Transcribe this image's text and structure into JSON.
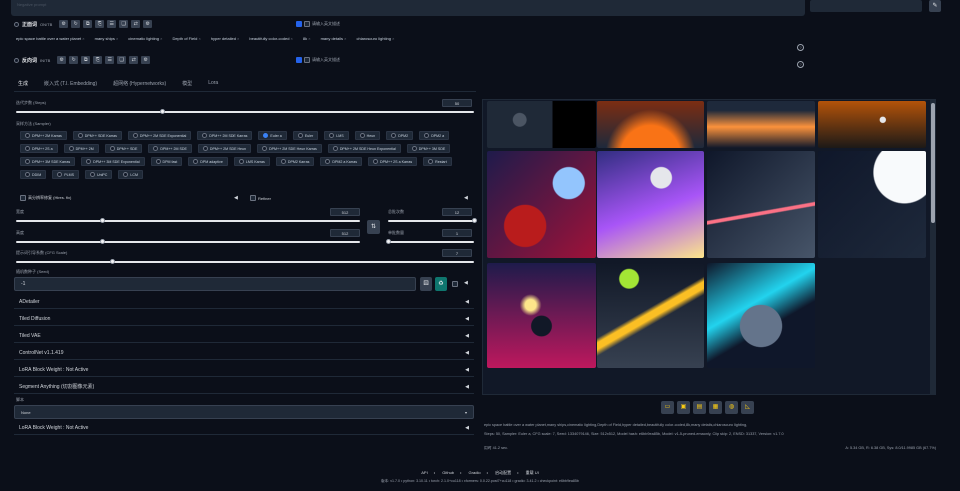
{
  "prompt_area": {
    "placeholder": "Negative prompt"
  },
  "positive": {
    "label": "正面词",
    "sub": "ON/TB",
    "checkbox_label": "请输入英文描述",
    "tags": [
      "epic space battle over a water planet",
      "many ships",
      "cinematic lighting",
      "Depth of Field",
      "hyper detailed",
      "beautifully color-coded",
      "8k",
      "many details",
      "chiaroscuro lighting"
    ]
  },
  "negative": {
    "label": "反向词",
    "sub": "IN/TB",
    "checkbox_label": "请输入英文描述"
  },
  "tabs": [
    "生成",
    "嵌入式 (T.I. Embedding)",
    "超网络 (Hypernetworks)",
    "模型",
    "Lora"
  ],
  "steps": {
    "label": "迭代步数 (Steps)",
    "value": "50",
    "fraction": 0.32
  },
  "sampler": {
    "label": "采样方法 (Sampler)",
    "selected": "Euler a",
    "options": [
      "DPM++ 2M Karras",
      "DPM++ SDE Karras",
      "DPM++ 2M SDE Exponential",
      "DPM++ 2M SDE Karras",
      "Euler a",
      "Euler",
      "LMS",
      "Heun",
      "DPM2",
      "DPM2 a",
      "DPM++ 2S a",
      "DPM++ 2M",
      "DPM++ SDE",
      "DPM++ 2M SDE",
      "DPM++ 2M SDE Heun",
      "DPM++ 2M SDE Heun Karras",
      "DPM++ 2M SDE Heun Exponential",
      "DPM++ 3M SDE",
      "DPM++ 3M SDE Karras",
      "DPM++ 3M SDE Exponential",
      "DPM fast",
      "DPM adaptive",
      "LMS Karras",
      "DPM2 Karras",
      "DPM2 a Karras",
      "DPM++ 2S a Karras",
      "Restart",
      "DDIM",
      "PLMS",
      "UniPC",
      "LCM"
    ]
  },
  "hires": {
    "label": "高分辨率修复 (Hires. fix)"
  },
  "refiner": {
    "label": "Refiner"
  },
  "width": {
    "label": "宽度",
    "value": "512",
    "fraction": 0.25
  },
  "height": {
    "label": "高度",
    "value": "512",
    "fraction": 0.25
  },
  "batch_count": {
    "label": "总批次数",
    "value": "12",
    "fraction": 1.0
  },
  "batch_size": {
    "label": "单批数量",
    "value": "1",
    "fraction": 0.0
  },
  "cfg": {
    "label": "提示词引导系数 (CFG Scale)",
    "value": "7",
    "fraction": 0.21
  },
  "seed": {
    "label": "随机数种子 (Seed)",
    "value": "-1"
  },
  "accordions": [
    "ADetailer",
    "Tiled Diffusion",
    "Tiled VAE",
    "ControlNet v1.1.419",
    "LoRA Block Weight : Not Active",
    "Segment Anything (切割图像元素)"
  ],
  "script": {
    "label": "脚本",
    "value": "None"
  },
  "last_accordion": "LoRA Block Weight : Not Active",
  "toolbar_icons": [
    "folder-icon",
    "save-icon",
    "zip-icon",
    "image-icon",
    "palette-icon",
    "ruler-icon"
  ],
  "info": {
    "line1": "epic space battle over a water planet,many ships,cinematic lighting,Depth of Field,hyper detailed,beautifully color-coded,8k,many details,chiaroscuro lighting,",
    "line2": "Steps: 50, Sampler: Euler a, CFG scale: 7, Seed: 1334079146, Size: 512x512, Model hash: e6bb9ea85b, Model: v1-5-pruned-emaonly, Clip skip: 2, ENSD: 31337, Version: v1.7.0",
    "time": "用时 41.2 sec.",
    "vram": "A: 5.34 GB, R: 6.38 GB, Sys: 8.0/11.9985 GB (67.7%)"
  },
  "footer": {
    "links": [
      "API",
      "Github",
      "Gradio",
      "启动配置",
      "重载 UI"
    ],
    "versions": "版本: v1.7.0  •  python: 3.10.11  •  torch: 2.1.0+cu118  •  xformers: 0.0.22.post7+cu118  •  gradio: 3.41.2  •  checkpoint: e6bb9ea85b"
  }
}
